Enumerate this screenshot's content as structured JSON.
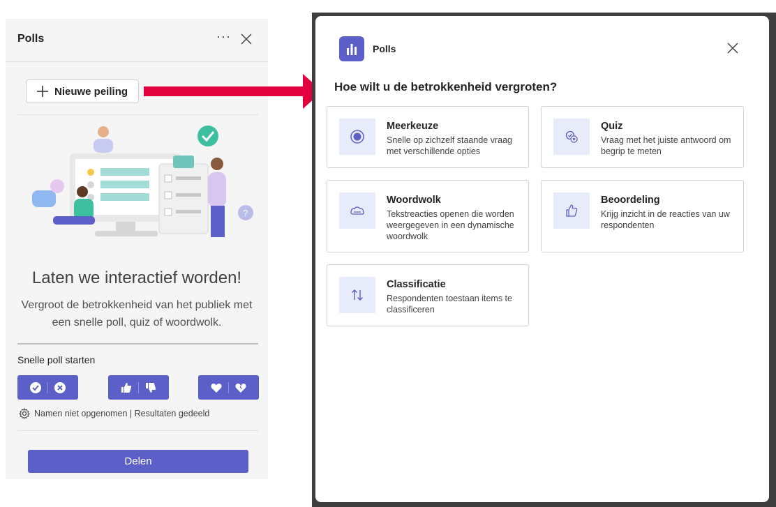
{
  "left_panel": {
    "title": "Polls",
    "more_label": "···",
    "new_poll_label": "Nieuwe peiling",
    "hero_title": "Laten we interactief worden!",
    "hero_subtitle": "Vergroot de betrokkenheid van het publiek met een snelle poll, quiz of woordwolk.",
    "quick_poll_label": "Snelle poll starten",
    "quick_buttons": [
      {
        "name": "check-cross"
      },
      {
        "name": "thumbs-up-down"
      },
      {
        "name": "heart-broken-heart"
      }
    ],
    "settings_text": "Namen niet opgenomen | Resultaten gedeeld",
    "share_label": "Delen"
  },
  "dialog": {
    "app_name": "Polls",
    "question": "Hoe wilt u de betrokkenheid vergroten?",
    "options": [
      {
        "title": "Meerkeuze",
        "description": "Snelle op zichzelf staande vraag met verschillende opties",
        "icon": "radio-icon"
      },
      {
        "title": "Quiz",
        "description": "Vraag met het juiste antwoord om begrip te meten",
        "icon": "quiz-icon"
      },
      {
        "title": "Woordwolk",
        "description": "Tekstreacties openen die worden weergegeven in een dynamische woordwolk",
        "icon": "cloud-icon"
      },
      {
        "title": "Beoordeling",
        "description": "Krijg inzicht in de reacties van uw respondenten",
        "icon": "thumbs-up-icon"
      },
      {
        "title": "Classificatie",
        "description": "Respondenten toestaan items te classificeren",
        "icon": "sort-arrows-icon"
      }
    ]
  },
  "colors": {
    "accent": "#5b5fc7",
    "accent_light": "#e8ebfa",
    "arrow": "#e3003f"
  }
}
